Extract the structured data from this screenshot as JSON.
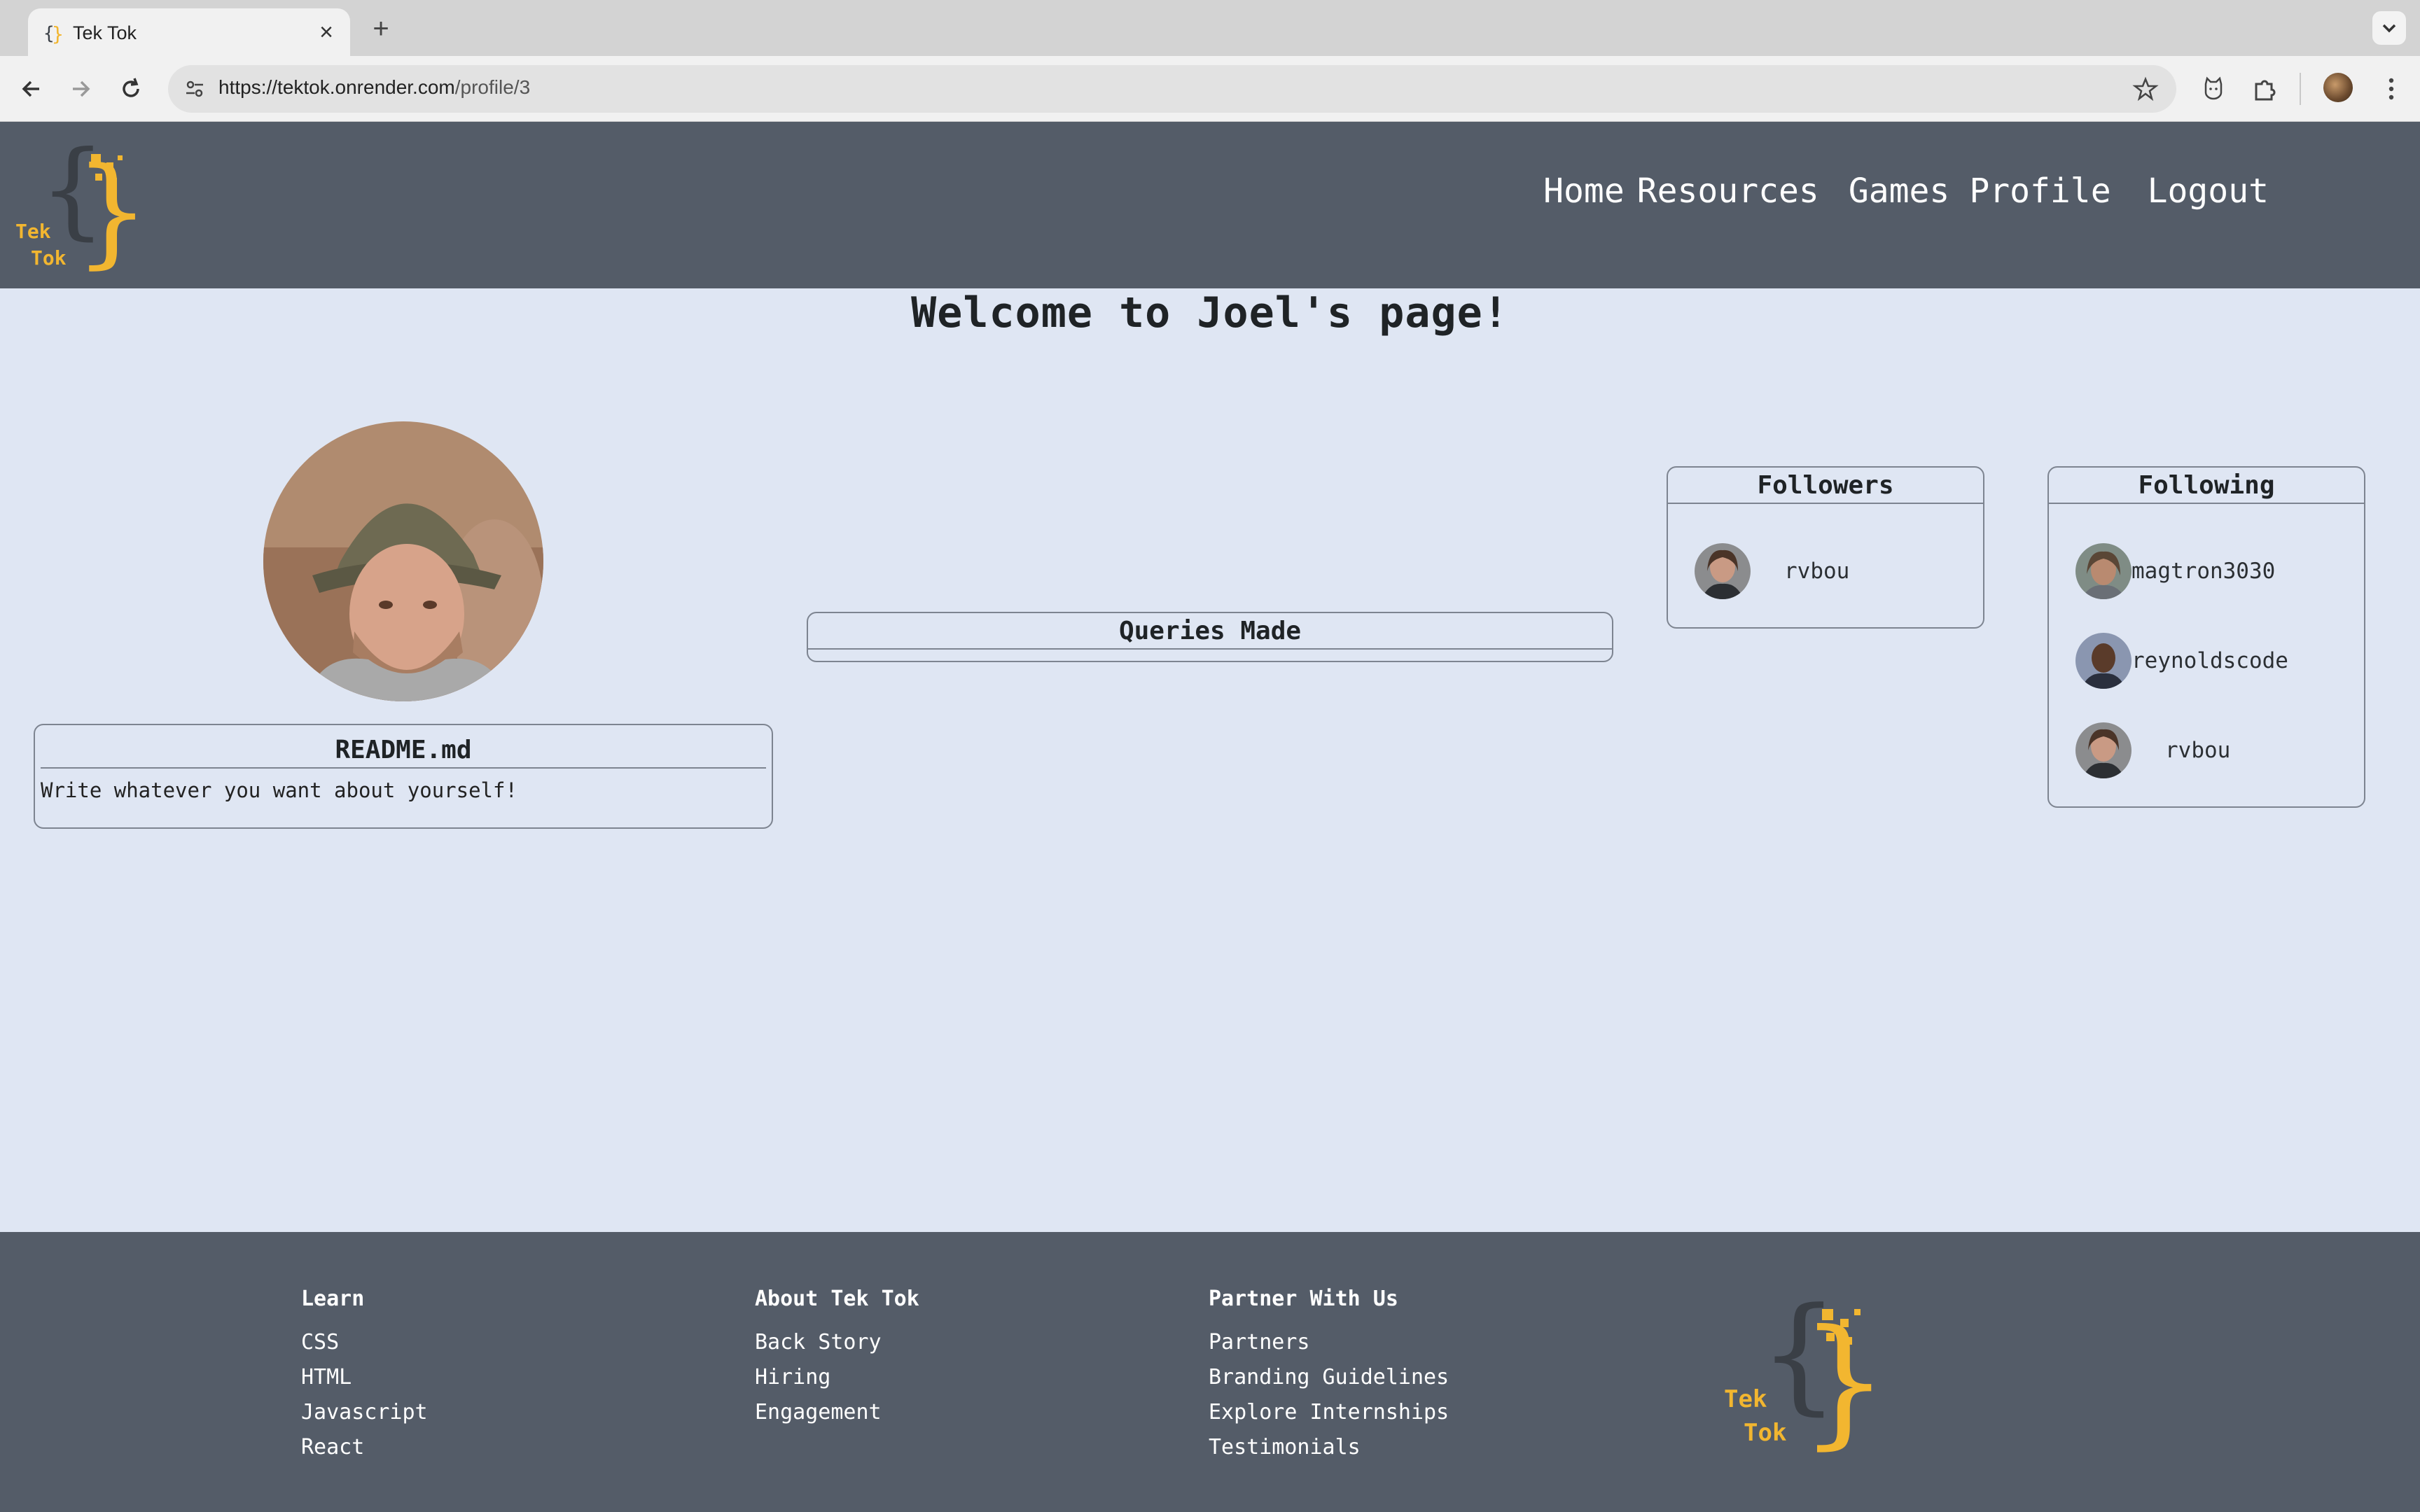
{
  "browser": {
    "tab_title": "Tek Tok",
    "url_host": "https://tektok.onrender.com",
    "url_path": "/profile/3"
  },
  "header": {
    "logo_text_top": "Tek",
    "logo_text_bottom": "Tok",
    "nav": {
      "home": "Home",
      "resources": "Resources",
      "games": "Games",
      "profile": "Profile",
      "logout": "Logout"
    }
  },
  "main": {
    "welcome": "Welcome to Joel's page!",
    "readme_title": "README.md",
    "readme_body": "Write whatever you want about yourself!",
    "queries_title": "Queries Made",
    "followers": {
      "title": "Followers",
      "users": [
        {
          "name": "rvbou"
        }
      ]
    },
    "following": {
      "title": "Following",
      "users": [
        {
          "name": "magtron3030"
        },
        {
          "name": "reynoldscode"
        },
        {
          "name": "rvbou"
        }
      ]
    }
  },
  "footer": {
    "learn": {
      "title": "Learn",
      "links": [
        "CSS",
        "HTML",
        "Javascript",
        "React"
      ]
    },
    "about": {
      "title": "About Tek Tok",
      "links": [
        "Back Story",
        "Hiring",
        "Engagement"
      ]
    },
    "partner": {
      "title": "Partner With Us",
      "links": [
        "Partners",
        "Branding Guidelines",
        "Explore Internships",
        "Testimonials"
      ]
    },
    "logo_text_top": "Tek",
    "logo_text_bottom": "Tok"
  },
  "colors": {
    "header_bg": "#545c68",
    "page_bg": "#dfe6f3",
    "brand_yellow": "#f2b630",
    "brand_dark": "#3a3f46"
  }
}
